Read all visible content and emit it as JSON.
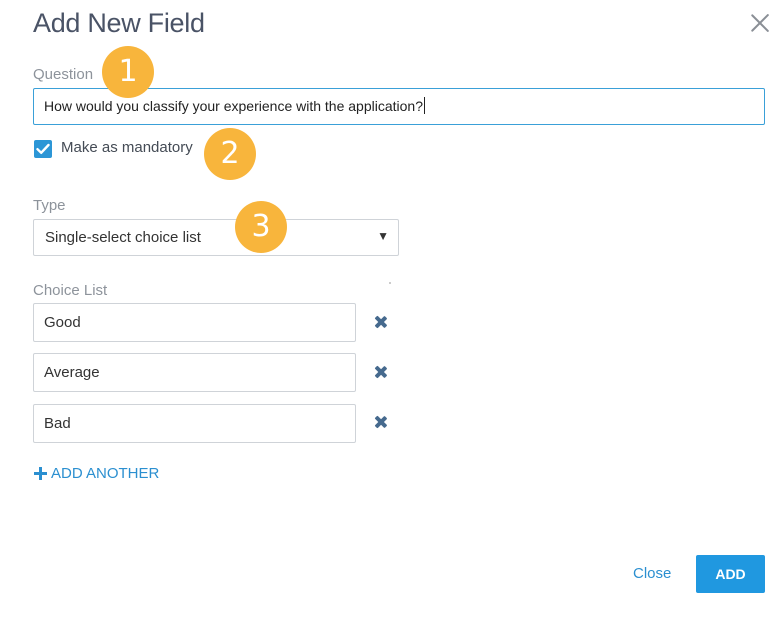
{
  "dialog": {
    "title": "Add New Field",
    "close_icon": "close-icon"
  },
  "question": {
    "label": "Question",
    "value": "How would you classify your experience with the application?"
  },
  "mandatory": {
    "label": "Make as mandatory",
    "checked": true
  },
  "type": {
    "label": "Type",
    "selected": "Single-select choice list"
  },
  "choices": {
    "label": "Choice List",
    "items": [
      "Good",
      "Average",
      "Bad"
    ],
    "remove_icon": "remove-icon"
  },
  "add_another": {
    "label": "ADD ANOTHER",
    "icon": "plus-icon"
  },
  "footer": {
    "close_label": "Close",
    "add_label": "ADD"
  },
  "badges": [
    "1",
    "2",
    "3"
  ],
  "colors": {
    "accent": "#2098e0",
    "badge": "#f8b53c",
    "remove_icon": "#466a8e"
  }
}
